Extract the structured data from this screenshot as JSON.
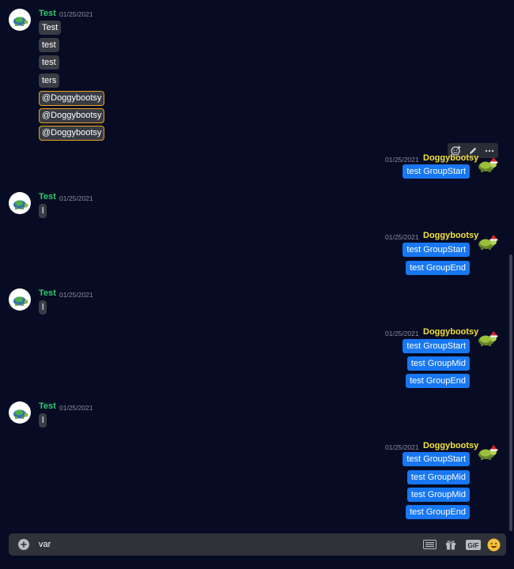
{
  "left_groups": [
    {
      "user": "Test",
      "time": "01/25/2021",
      "messages": [
        "Test",
        "test",
        "test",
        "ters"
      ],
      "mentions": [
        "@Doggybootsy",
        "@Doggybootsy",
        "@Doggybootsy"
      ]
    },
    {
      "user": "Test",
      "time": "01/25/2021",
      "messages": [
        "l"
      ]
    },
    {
      "user": "Test",
      "time": "01/25/2021",
      "messages": [
        "l"
      ]
    },
    {
      "user": "Test",
      "time": "01/25/2021",
      "messages": [
        "l"
      ]
    }
  ],
  "right_groups": [
    {
      "user": "Doggybootsy",
      "time": "01/25/2021",
      "messages": [
        "test GroupStart"
      ]
    },
    {
      "user": "Doggybootsy",
      "time": "01/25/2021",
      "messages": [
        "test GroupStart",
        "test GroupEnd"
      ]
    },
    {
      "user": "Doggybootsy",
      "time": "01/25/2021",
      "messages": [
        "test GroupStart",
        "test GroupMid",
        "test GroupEnd"
      ]
    },
    {
      "user": "Doggybootsy",
      "time": "01/25/2021",
      "messages": [
        "test GroupStart",
        "test GroupMid",
        "test GroupMid",
        "test GroupEnd"
      ]
    }
  ],
  "hover_toolbar": {
    "icons": [
      "add-reaction-icon",
      "edit-pencil-icon",
      "more-options-icon"
    ]
  },
  "composer": {
    "value": "var",
    "icons": [
      "add-attachment-icon",
      "keyboard-icon",
      "gift-icon",
      "gif-icon",
      "emoji-icon"
    ],
    "gif_label": "GIF"
  },
  "colors": {
    "background": "#070b23",
    "left_name": "#2ecc71",
    "right_name": "#f4e13a",
    "right_bubble": "#1877f2",
    "left_bubble": "#3a3c44",
    "mention_border": "#e8a020",
    "composer": "#2f3238"
  }
}
